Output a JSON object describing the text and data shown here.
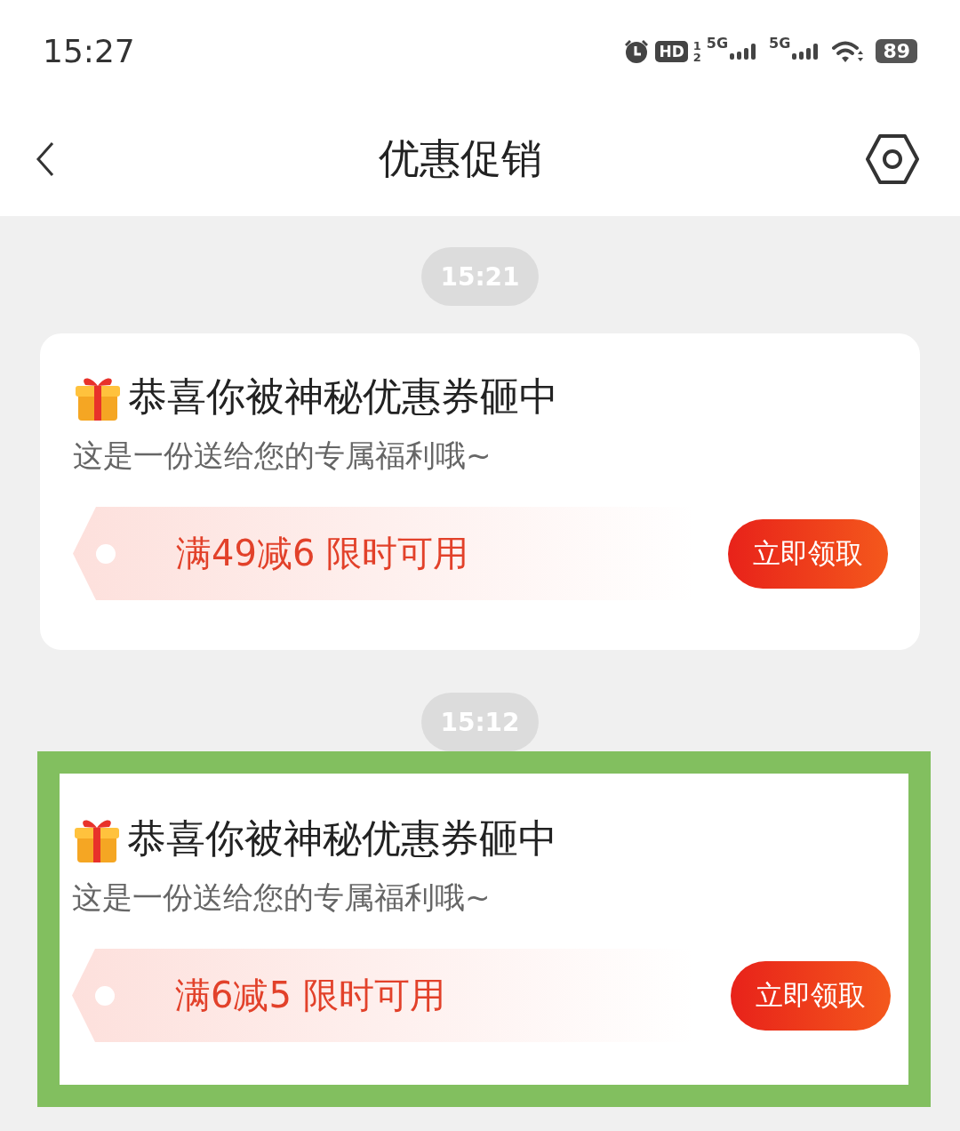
{
  "status_bar": {
    "time": "15:27",
    "hd_label": "HD",
    "sim_1": "1",
    "sim_2": "2",
    "network_1": "5G",
    "network_2": "5G",
    "battery": "89"
  },
  "header": {
    "title": "优惠促销"
  },
  "messages": [
    {
      "time": "15:21",
      "title": "恭喜你被神秘优惠券砸中",
      "subtitle": "这是一份送给您的专属福利哦~",
      "coupon": "满49减6 限时可用",
      "button": "立即领取",
      "highlighted": false
    },
    {
      "time": "15:12",
      "title": "恭喜你被神秘优惠券砸中",
      "subtitle": "这是一份送给您的专属福利哦~",
      "coupon": "满6减5 限时可用",
      "button": "立即领取",
      "highlighted": true
    }
  ]
}
